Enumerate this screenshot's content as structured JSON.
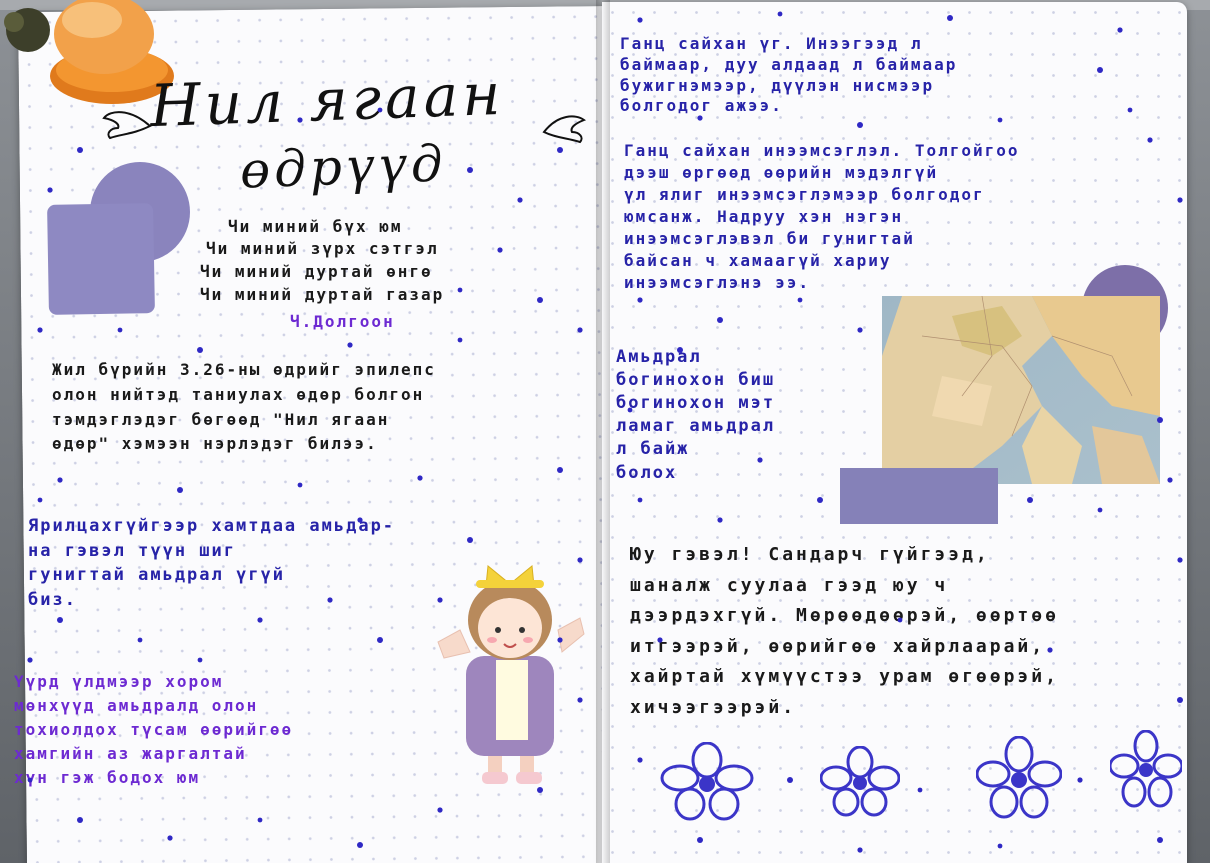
{
  "title": {
    "line1": "Нил ягаан",
    "line2": "өдрүүд"
  },
  "poem": {
    "lines": [
      "Чи миний бүх юм",
      "Чи миний зүрх сэтгэл",
      "Чи миний дуртай өнгө",
      "Чи миний дуртай газар"
    ],
    "author": "Ч.Долгоон"
  },
  "left": {
    "para1": "Жил бүрийн 3.26-ны өдрийг эпилепс\nолон нийтэд таниулах өдөр болгон\nтэмдэглэдэг бөгөөд \"Нил ягаан\nөдөр\" хэмээн нэрлэдэг билээ.",
    "para2": "Ярилцахгүйгээр хамтдаа амьдар-\nна гэвэл түүн шиг\nгунигтай амьдрал үгүй\nбиз.",
    "para3": "Үүрд үлдмээр хором\nмөнхүүд амьдралд олон\nтохиолдох түсам өөрийгөө\nхамгийн аз жаргалтай\nхүн гэж бодох юм"
  },
  "right": {
    "para1": "Ганц сайхан үг. Инээгээд л\nбаймаар, дуу алдаад л баймаар\nбужигнэмээр, дүүлэн нисмээр\nболгодог ажээ.",
    "para2": "Ганц сайхан инээмсэглэл. Толгойгоо\nдээш өргөөд өөрийн мэдэлгүй\nүл ялиг инээмсэглэмээр болгодог\nюмсанж. Надруу хэн нэгэн\nинээмсэглэвэл би гунигтай\nбайсан ч хамаагүй хариу\nинээмсэглэнэ ээ.",
    "para3": "Амьдрал\nбогинохон биш\nбогинохон мэт\nламаг амьдрал\nл байж\nболох",
    "para4": "Юу гэвэл! Сандарч гүйгээд,\nшаналж суулаа гээд юу ч\nдээрдэхгүй. Мөрөөдөөрэй, өөртөө\nитгээрэй, өөрийгөө хайрлаарай,\nхайртай хүмүүстээ урам өгөөрэй,\nхичээгээрэй."
  },
  "colors": {
    "ink": "#3c2fc9",
    "sticker": "#8a84bd",
    "paper": "#fbfbfd"
  }
}
